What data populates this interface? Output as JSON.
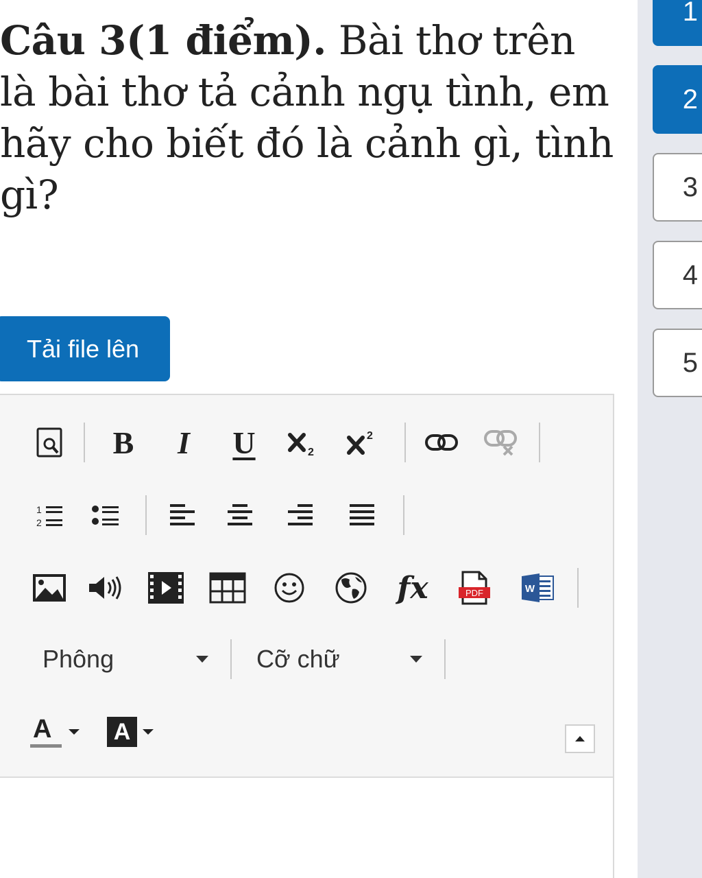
{
  "question": {
    "label": "Câu 3(1 điểm).",
    "text": " Bài thơ trên là bài thơ tả cảnh ngụ tình, em hãy cho biết đó là cảnh gì, tình gì?"
  },
  "upload_button": {
    "label": "Tải file lên"
  },
  "question_nav": {
    "items": [
      {
        "label": "1",
        "state": "answered"
      },
      {
        "label": "2",
        "state": "current"
      },
      {
        "label": "3",
        "state": "default"
      },
      {
        "label": "4",
        "state": "default"
      },
      {
        "label": "5",
        "state": "default"
      }
    ]
  },
  "toolbar": {
    "bold_label": "B",
    "italic_label": "I",
    "underline_label": "U",
    "fx_label": "fx",
    "pdf_label": "PDF",
    "word_label": "W",
    "font_select": {
      "value": "Phông"
    },
    "size_select": {
      "value": "Cỡ chữ"
    },
    "text_color_label": "A",
    "bg_color_label": "A"
  },
  "colors": {
    "accent": "#0d6eb8",
    "pdf_red": "#d9252b",
    "word_blue": "#2b5797",
    "sidebar_bg": "#e6e8ee"
  },
  "icons": [
    "preview-icon",
    "subscript-icon",
    "superscript-icon",
    "link-icon",
    "unlink-icon",
    "ordered-list-icon",
    "bullet-list-icon",
    "align-left-icon",
    "align-center-icon",
    "align-right-icon",
    "align-justify-icon",
    "image-icon",
    "audio-icon",
    "video-icon",
    "table-icon",
    "emoji-icon",
    "globe-icon",
    "formula-icon",
    "pdf-icon",
    "word-icon",
    "text-color-icon",
    "background-color-icon",
    "collapse-icon"
  ]
}
